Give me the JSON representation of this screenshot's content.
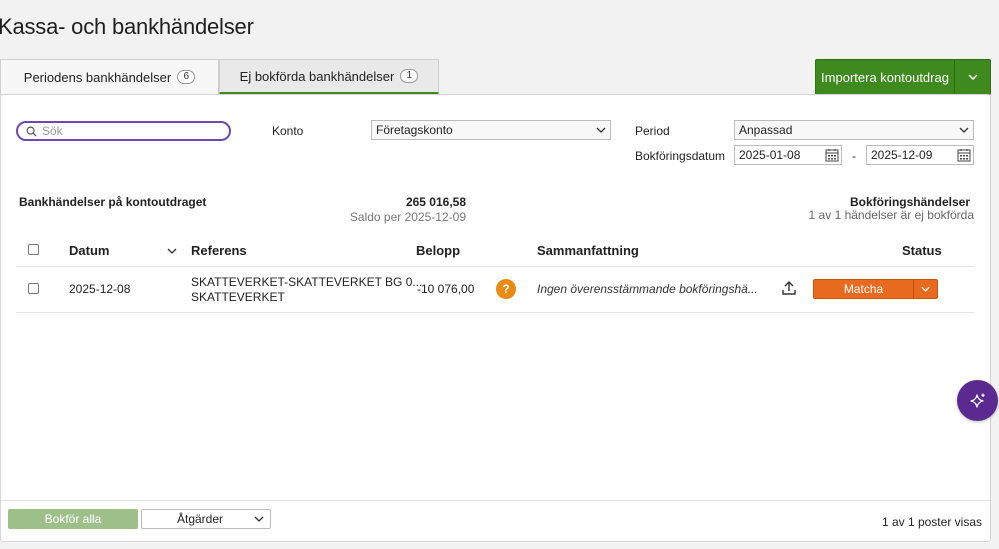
{
  "page": {
    "title": "Kassa- och bankhändelser"
  },
  "tabs": [
    {
      "label": "Periodens bankhändelser",
      "count": "6"
    },
    {
      "label": "Ej bokförda bankhändelser",
      "count": "1"
    }
  ],
  "import_button": {
    "label": "Importera kontoutdrag"
  },
  "filters": {
    "search_placeholder": "Sök",
    "konto_label": "Konto",
    "konto_value": "Företagskonto",
    "period_label": "Period",
    "period_value": "Anpassad",
    "date_label": "Bokföringsdatum",
    "date_from": "2025-01-08",
    "date_separator": "-",
    "date_to": "2025-12-09"
  },
  "summary": {
    "left_title": "Bankhändelser på kontoutdraget",
    "amount": "265 016,58",
    "saldo": "Saldo per 2025-12-09",
    "right_title": "Bokföringshändelser",
    "right_subtitle": "1 av 1 händelser är ej bokförda"
  },
  "table": {
    "headers": {
      "datum": "Datum",
      "referens": "Referens",
      "belopp": "Belopp",
      "sammanfattning": "Sammanfattning",
      "status": "Status"
    },
    "rows": [
      {
        "datum": "2025-12-08",
        "referens_line1": "SKATTEVERKET-SKATTEVERKET BG 0...",
        "referens_line2": "SKATTEVERKET",
        "belopp": "-10 076,00",
        "sammanfattning": "Ingen överensstämmande bokföringshä...",
        "status_button": "Matcha"
      }
    ]
  },
  "footer": {
    "bokfor_all": "Bokför alla",
    "actions": "Åtgärder",
    "count": "1 av 1 poster visas"
  },
  "colors": {
    "accent_green": "#3f8a1f",
    "match_orange": "#e86a1e",
    "search_focus": "#6c4ab0",
    "ai_purple": "#5b2a91"
  },
  "icons": [
    "search-icon",
    "chevron-down-icon",
    "calendar-icon",
    "question-icon",
    "upload-icon",
    "sparkle-icon"
  ]
}
